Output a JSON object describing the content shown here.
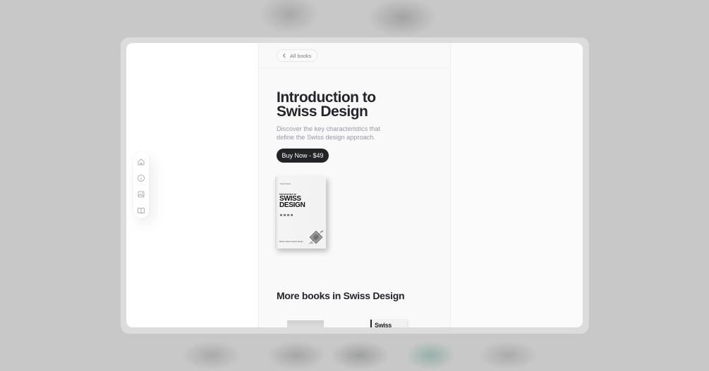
{
  "nav": {
    "back_label": "All books",
    "icons": [
      "home-icon",
      "info-icon",
      "image-icon",
      "book-open-icon"
    ]
  },
  "product": {
    "title": "Introduction to Swiss Design",
    "subtitle": "Discover the key characteristics that define the Swiss design approach.",
    "buy_label": "Buy Now - $49"
  },
  "cover": {
    "author": "Sarah Abels",
    "intro": "Introduction to",
    "main_line1": "SWISS",
    "main_line2": "DESIGN",
    "footer": "Modern Swiss Graphic Design"
  },
  "more": {
    "title": "More books in Swiss Design",
    "thumb2_text": "Swiss"
  },
  "colors": {
    "accent": "#222326",
    "background": "#c9c9c9",
    "panel": "#f9f9fa"
  }
}
